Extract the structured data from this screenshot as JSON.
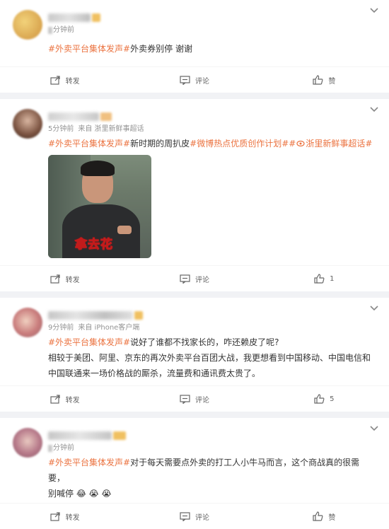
{
  "posts": [
    {
      "time": "分钟前",
      "source": "",
      "tag": "#外卖平台集体发声#",
      "text": "外卖券别停 谢谢",
      "extra_lines": [],
      "actions": {
        "repost": "转发",
        "comment": "评论",
        "like": "赞"
      },
      "avatar_colors": [
        "#e8c56a",
        "#d89a5b"
      ]
    },
    {
      "time": "5分钟前",
      "source": "来自 浙里新鲜事超话",
      "tag": "#外卖平台集体发声#",
      "text": "新时期的周扒皮",
      "hot_tag": "#微博热点优质创作计划#",
      "super_tag": "浙里新鲜事超话",
      "image_caption": "拿去花",
      "extra_lines": [],
      "actions": {
        "repost": "转发",
        "comment": "评论",
        "like": "1"
      },
      "avatar_colors": [
        "#6b4a3a",
        "#b98e74"
      ]
    },
    {
      "time": "9分钟前",
      "source": "来自 iPhone客户端",
      "tag": "#外卖平台集体发声#",
      "text": "说好了谁都不找家长的，咋还赖皮了呢?",
      "extra_lines": [
        "相较于美团、阿里、京东的再次外卖平台百团大战，我更想看到中国移动、中国电信和",
        "中国联通来一场价格战的厮杀，流量费和通讯费太贵了。"
      ],
      "actions": {
        "repost": "转发",
        "comment": "评论",
        "like": "5"
      },
      "avatar_colors": [
        "#c97c7c",
        "#e0b8a0"
      ]
    },
    {
      "time": "分钟前",
      "source": "",
      "tag": "#外卖平台集体发声#",
      "text": "对于每天需要点外卖的打工人小牛马而言，这个商战真的很需要，",
      "extra_lines": [
        "别喊停 😂 😭 😭"
      ],
      "actions": {
        "repost": "转发",
        "comment": "评论",
        "like": "赞"
      },
      "avatar_colors": [
        "#b77a8a",
        "#d6a7a0"
      ]
    }
  ],
  "colors": {
    "accent": "#eb7340",
    "meta": "#939393",
    "action": "#636363",
    "bg": "#f1f2f5"
  },
  "icons": [
    "chevron-down-icon",
    "repost-icon",
    "comment-icon",
    "like-icon"
  ]
}
